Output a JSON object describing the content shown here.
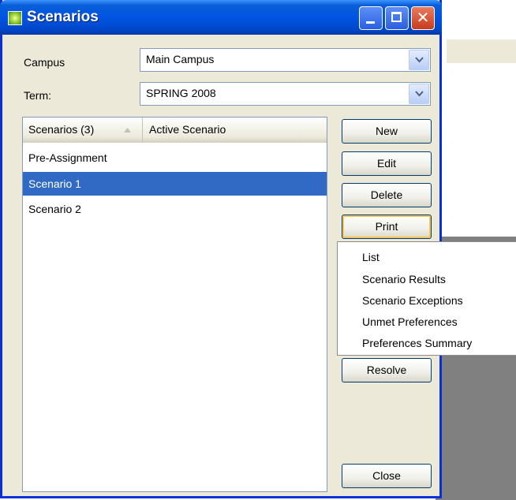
{
  "window": {
    "title": "Scenarios"
  },
  "campus": {
    "label": "Campus",
    "value": "Main Campus"
  },
  "term": {
    "label": "Term:",
    "value": "SPRING 2008"
  },
  "list": {
    "columns": [
      "Scenarios (3)",
      "Active Scenario"
    ],
    "rows": [
      {
        "name": "Pre-Assignment",
        "selected": false
      },
      {
        "name": "Scenario 1",
        "selected": true
      },
      {
        "name": "Scenario 2",
        "selected": false
      }
    ]
  },
  "buttons": {
    "new": "New",
    "edit": "Edit",
    "delete": "Delete",
    "print": "Print",
    "resolve": "Resolve",
    "close": "Close"
  },
  "print_menu": {
    "items": [
      "List",
      "Scenario Results",
      "Scenario Exceptions",
      "Unmet Preferences",
      "Preferences Summary"
    ]
  },
  "colors": {
    "selection": "#316ac5",
    "titlebar": "#0054e3",
    "dialog_bg": "#ece9d8"
  },
  "icons": {
    "app": "scenario-app-icon",
    "sort": "sort-ascending-icon",
    "dropdown": "chevron-down-icon"
  }
}
